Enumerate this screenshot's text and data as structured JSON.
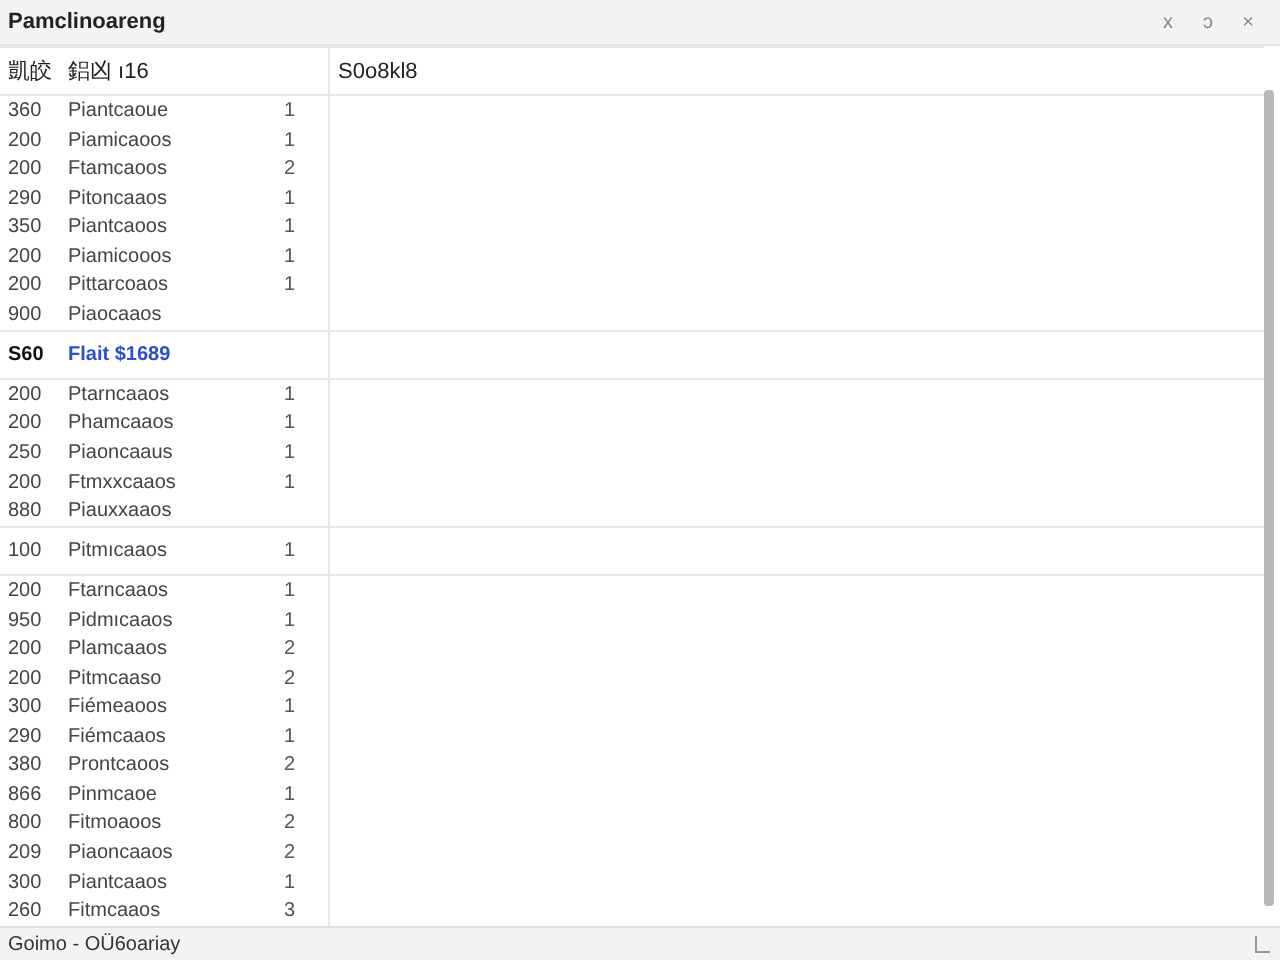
{
  "window": {
    "title": "Pamclinoareng",
    "controls": [
      "x",
      "ↄ",
      "×"
    ]
  },
  "columns": [
    "凱皎",
    "鋁凶  ı16",
    "S0o8kl8"
  ],
  "rows": [
    {
      "kind": "item",
      "code": "360",
      "name": "Piantcaoue",
      "count": "1"
    },
    {
      "kind": "item",
      "code": "200",
      "name": "Piamicaoos",
      "count": "1"
    },
    {
      "kind": "item",
      "code": "200",
      "name": "Ftamcaoos",
      "count": "2"
    },
    {
      "kind": "item",
      "code": "290",
      "name": "Pitoncaaos",
      "count": "1"
    },
    {
      "kind": "item",
      "code": "350",
      "name": "Piantcaoos",
      "count": "1"
    },
    {
      "kind": "item",
      "code": "200",
      "name": "Piamicooos",
      "count": "1"
    },
    {
      "kind": "item",
      "code": "200",
      "name": "Pittarcoaos",
      "count": "1"
    },
    {
      "kind": "item",
      "code": "900",
      "name": "Piaocaaos"
    },
    {
      "kind": "group",
      "code": "S60",
      "name": "Flait $1689"
    },
    {
      "kind": "item",
      "code": "200",
      "name": "Ptarncaaos",
      "count": "1"
    },
    {
      "kind": "item",
      "code": "200",
      "name": "Phamcaaos",
      "count": "1"
    },
    {
      "kind": "item",
      "code": "250",
      "name": "Piaoncaaus",
      "count": "1"
    },
    {
      "kind": "item",
      "code": "200",
      "name": "Ftmxxcaaos",
      "count": "1"
    },
    {
      "kind": "item",
      "code": "880",
      "name": "Piauxxaaos"
    },
    {
      "kind": "break",
      "code": "100",
      "name": "Pitmıcaaos",
      "count": "1"
    },
    {
      "kind": "item",
      "code": "200",
      "name": "Ftarncaaos",
      "count": "1"
    },
    {
      "kind": "item",
      "code": "950",
      "name": "Pidmıcaaos",
      "count": "1"
    },
    {
      "kind": "item",
      "code": "200",
      "name": "Plamcaaos",
      "count": "2"
    },
    {
      "kind": "item",
      "code": "200",
      "name": "Pitmcaaso",
      "count": "2"
    },
    {
      "kind": "item",
      "code": "300",
      "name": "Fiémeaoos",
      "count": "1"
    },
    {
      "kind": "item",
      "code": "290",
      "name": "Fiémcaaos",
      "count": "1"
    },
    {
      "kind": "item",
      "code": "380",
      "name": "Prontcaoos",
      "count": "2"
    },
    {
      "kind": "item",
      "code": "866",
      "name": "Pinmcaoe",
      "count": "1"
    },
    {
      "kind": "item",
      "code": "800",
      "name": "Fitmoaoos",
      "count": "2"
    },
    {
      "kind": "item",
      "code": "209",
      "name": "Piaoncaaos",
      "count": "2"
    },
    {
      "kind": "item",
      "code": "300",
      "name": "Piantcaaos",
      "count": "1"
    },
    {
      "kind": "item",
      "code": "260",
      "name": "Fitmcaaos",
      "count": "3"
    }
  ],
  "status_bar": {
    "text": "Goimo - ОÜ6oariay"
  }
}
